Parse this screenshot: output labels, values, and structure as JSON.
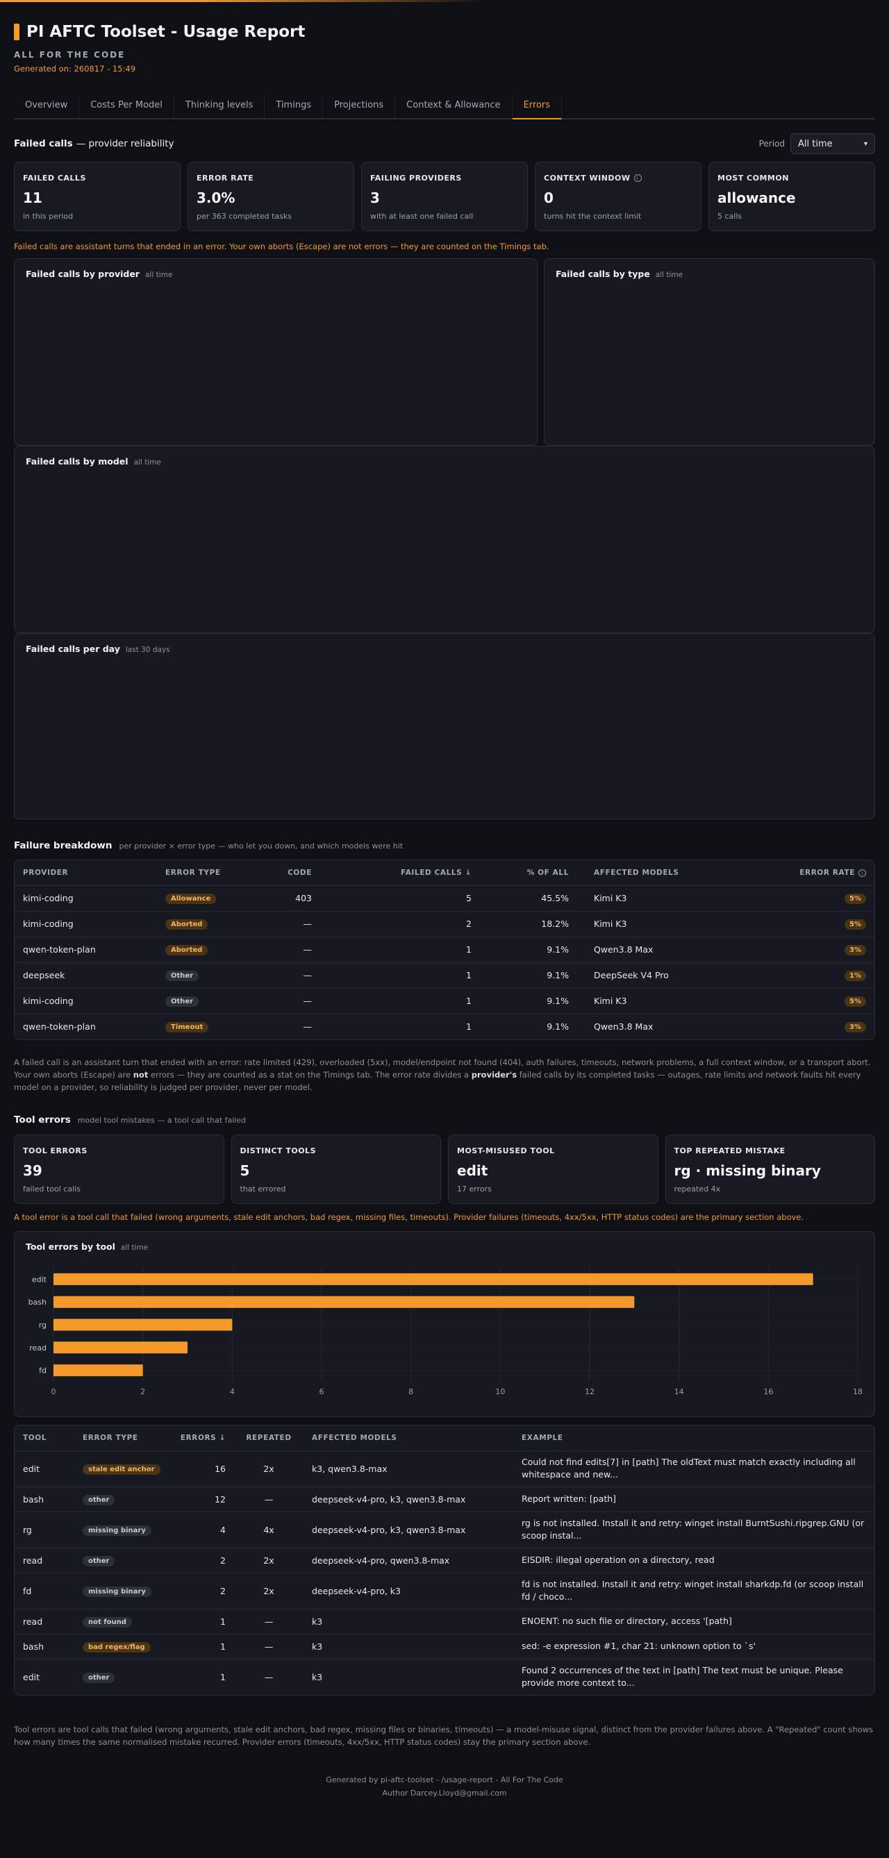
{
  "header": {
    "title": "PI AFTC Toolset - Usage Report",
    "subtitle": "ALL FOR THE CODE",
    "generated": "Generated on: 260817 - 15:49"
  },
  "tabs": [
    {
      "label": "Overview"
    },
    {
      "label": "Costs Per Model"
    },
    {
      "label": "Thinking levels"
    },
    {
      "label": "Timings"
    },
    {
      "label": "Projections"
    },
    {
      "label": "Context & Allowance"
    },
    {
      "label": "Errors"
    }
  ],
  "failed": {
    "title": "Failed calls",
    "title_suffix": "— provider reliability",
    "period_label": "Period",
    "period_value": "All time",
    "cards": [
      {
        "label": "FAILED CALLS",
        "value": "11",
        "sub": "in this period"
      },
      {
        "label": "ERROR RATE",
        "value": "3.0%",
        "sub": "per 363 completed tasks"
      },
      {
        "label": "FAILING PROVIDERS",
        "value": "3",
        "sub": "with at least one failed call"
      },
      {
        "label": "CONTEXT WINDOW",
        "value": "0",
        "sub": "turns hit the context limit"
      },
      {
        "label": "MOST COMMON",
        "value": "allowance",
        "sub": "5 calls"
      }
    ],
    "note": "Failed calls are assistant turns that ended in an error. Your own aborts (Escape) are not errors — they are counted on the Timings tab.",
    "panels": {
      "by_provider": {
        "title": "Failed calls by provider",
        "note": "all time"
      },
      "by_type": {
        "title": "Failed calls by type",
        "note": "all time"
      },
      "by_model": {
        "title": "Failed calls by model",
        "note": "all time"
      },
      "per_day": {
        "title": "Failed calls per day",
        "note": "last 30 days"
      }
    }
  },
  "breakdown": {
    "title": "Failure breakdown",
    "note": "per provider × error type — who let you down, and which models were hit",
    "columns": [
      "PROVIDER",
      "ERROR TYPE",
      "CODE",
      "FAILED CALLS ↓",
      "% OF ALL",
      "AFFECTED MODELS",
      "ERROR RATE"
    ],
    "rows": [
      {
        "provider": "kimi-coding",
        "type": "Allowance",
        "code": "403",
        "calls": "5",
        "pct": "45.5%",
        "models": "Kimi K3",
        "rate": "5%"
      },
      {
        "provider": "kimi-coding",
        "type": "Aborted",
        "code": "—",
        "calls": "2",
        "pct": "18.2%",
        "models": "Kimi K3",
        "rate": "5%"
      },
      {
        "provider": "qwen-token-plan",
        "type": "Aborted",
        "code": "—",
        "calls": "1",
        "pct": "9.1%",
        "models": "Qwen3.8 Max",
        "rate": "3%"
      },
      {
        "provider": "deepseek",
        "type": "Other",
        "code": "—",
        "calls": "1",
        "pct": "9.1%",
        "models": "DeepSeek V4 Pro",
        "rate": "1%"
      },
      {
        "provider": "kimi-coding",
        "type": "Other",
        "code": "—",
        "calls": "1",
        "pct": "9.1%",
        "models": "Kimi K3",
        "rate": "5%"
      },
      {
        "provider": "qwen-token-plan",
        "type": "Timeout",
        "code": "—",
        "calls": "1",
        "pct": "9.1%",
        "models": "Qwen3.8 Max",
        "rate": "3%"
      }
    ],
    "footnote_1": "A failed call is an assistant turn that ended with an error: rate limited (429), overloaded (5xx), model/endpoint not found (404), auth failures, timeouts, network problems, a full context window, or a transport abort. Your own aborts (Escape) are ",
    "footnote_not": "not",
    "footnote_2": " errors — they are counted as a stat on the Timings tab. The error rate divides a ",
    "footnote_provider": "provider's",
    "footnote_3": " failed calls by its completed tasks — outages, rate limits and network faults hit every model on a provider, so reliability is judged per provider, never per model."
  },
  "tool_errors": {
    "title": "Tool errors",
    "note": "model tool mistakes — a tool call that failed",
    "cards": [
      {
        "label": "TOOL ERRORS",
        "value": "39",
        "sub": "failed tool calls"
      },
      {
        "label": "DISTINCT TOOLS",
        "value": "5",
        "sub": "that errored"
      },
      {
        "label": "MOST-MISUSED TOOL",
        "value": "edit",
        "sub": "17 errors"
      },
      {
        "label": "TOP REPEATED MISTAKE",
        "value": "rg · missing binary",
        "sub": "repeated 4x"
      }
    ],
    "note_orange": "A tool error is a tool call that failed (wrong arguments, stale edit anchors, bad regex, missing files, timeouts). Provider failures (timeouts, 4xx/5xx, HTTP status codes) are the primary section above.",
    "chart_panel": {
      "title": "Tool errors by tool",
      "note": "all time"
    },
    "columns": [
      "TOOL",
      "ERROR TYPE",
      "ERRORS ↓",
      "REPEATED",
      "AFFECTED MODELS",
      "EXAMPLE"
    ],
    "rows": [
      {
        "tool": "edit",
        "type": "stale edit anchor",
        "tone": "orange",
        "errors": "16",
        "repeated": "2x",
        "models": "k3, qwen3.8-max",
        "example": "Could not find edits[7] in [path] The oldText must match exactly including all whitespace and new..."
      },
      {
        "tool": "bash",
        "type": "other",
        "tone": "gray",
        "errors": "12",
        "repeated": "—",
        "models": "deepseek-v4-pro, k3, qwen3.8-max",
        "example": "Report written: [path]"
      },
      {
        "tool": "rg",
        "type": "missing binary",
        "tone": "gray",
        "errors": "4",
        "repeated": "4x",
        "models": "deepseek-v4-pro, k3, qwen3.8-max",
        "example": "rg is not installed. Install it and retry: winget install BurntSushi.ripgrep.GNU (or scoop instal..."
      },
      {
        "tool": "read",
        "type": "other",
        "tone": "gray",
        "errors": "2",
        "repeated": "2x",
        "models": "deepseek-v4-pro, qwen3.8-max",
        "example": "EISDIR: illegal operation on a directory, read"
      },
      {
        "tool": "fd",
        "type": "missing binary",
        "tone": "gray",
        "errors": "2",
        "repeated": "2x",
        "models": "deepseek-v4-pro, k3",
        "example": "fd is not installed. Install it and retry: winget install sharkdp.fd (or scoop install fd / choco..."
      },
      {
        "tool": "read",
        "type": "not found",
        "tone": "gray",
        "errors": "1",
        "repeated": "—",
        "models": "k3",
        "example": "ENOENT: no such file or directory, access '[path]"
      },
      {
        "tool": "bash",
        "type": "bad regex/flag",
        "tone": "orange",
        "errors": "1",
        "repeated": "—",
        "models": "k3",
        "example": "sed: -e expression #1, char 21: unknown option to `s'"
      },
      {
        "tool": "edit",
        "type": "other",
        "tone": "gray",
        "errors": "1",
        "repeated": "—",
        "models": "k3",
        "example": "Found 2 occurrences of the text in [path] The text must be unique. Please provide more context to..."
      }
    ],
    "footnote": "Tool errors are tool calls that failed (wrong arguments, stale edit anchors, bad regex, missing files or binaries, timeouts) — a model-misuse signal, distinct from the provider failures above. A \"Repeated\" count shows how many times the same normalised mistake recurred. Provider errors (timeouts, 4xx/5xx, HTTP status codes) stay the primary section above."
  },
  "chart_data": {
    "type": "bar",
    "orientation": "horizontal",
    "categories": [
      "edit",
      "bash",
      "rg",
      "read",
      "fd"
    ],
    "values": [
      17,
      13,
      4,
      3,
      2
    ],
    "xlim": [
      0,
      18
    ],
    "xticks": [
      0,
      2,
      4,
      6,
      8,
      10,
      12,
      14,
      16,
      18
    ],
    "color": "#f39a2b",
    "grid": true
  },
  "footer": {
    "line1": "Generated by pi-aftc-toolset - /usage-report - All For The Code",
    "line2": "Author Darcey.Lloyd@gmail.com"
  }
}
